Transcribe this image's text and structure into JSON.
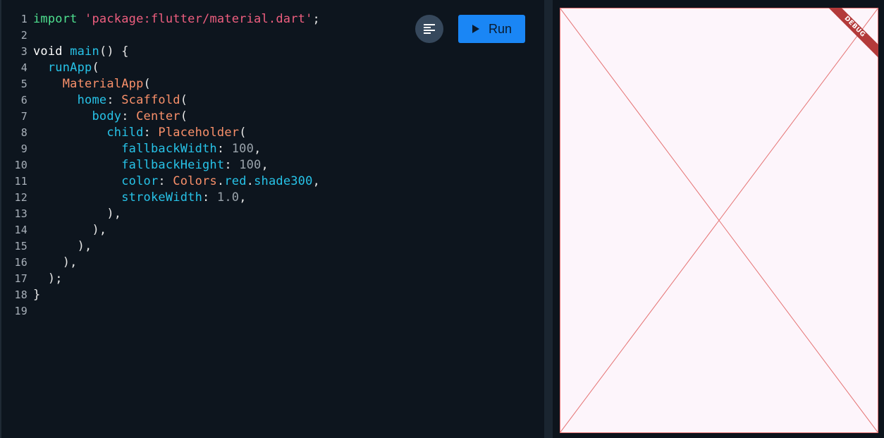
{
  "toolbar": {
    "format_icon": "format-align-left-icon",
    "run_label": "Run",
    "run_icon": "play-icon",
    "run_color": "#1a86f5"
  },
  "code": {
    "line_numbers": [
      "1",
      "2",
      "3",
      "4",
      "5",
      "6",
      "7",
      "8",
      "9",
      "10",
      "11",
      "12",
      "13",
      "14",
      "15",
      "16",
      "17",
      "18",
      "19"
    ],
    "lines": [
      [
        {
          "t": "import",
          "c": "kw-green"
        },
        {
          "t": " ",
          "c": "plain"
        },
        {
          "t": "'package:flutter/material.dart'",
          "c": "str"
        },
        {
          "t": ";",
          "c": "plain"
        }
      ],
      [],
      [
        {
          "t": "void",
          "c": "kw-white"
        },
        {
          "t": " ",
          "c": "plain"
        },
        {
          "t": "main",
          "c": "fn"
        },
        {
          "t": "() {",
          "c": "plain"
        }
      ],
      [
        {
          "t": "  ",
          "c": "plain"
        },
        {
          "t": "runApp",
          "c": "fn"
        },
        {
          "t": "(",
          "c": "plain"
        }
      ],
      [
        {
          "t": "    ",
          "c": "plain"
        },
        {
          "t": "MaterialApp",
          "c": "cls"
        },
        {
          "t": "(",
          "c": "plain"
        }
      ],
      [
        {
          "t": "      ",
          "c": "plain"
        },
        {
          "t": "home",
          "c": "fn"
        },
        {
          "t": ": ",
          "c": "plain"
        },
        {
          "t": "Scaffold",
          "c": "cls"
        },
        {
          "t": "(",
          "c": "plain"
        }
      ],
      [
        {
          "t": "        ",
          "c": "plain"
        },
        {
          "t": "body",
          "c": "fn"
        },
        {
          "t": ": ",
          "c": "plain"
        },
        {
          "t": "Center",
          "c": "cls"
        },
        {
          "t": "(",
          "c": "plain"
        }
      ],
      [
        {
          "t": "          ",
          "c": "plain"
        },
        {
          "t": "child",
          "c": "fn"
        },
        {
          "t": ": ",
          "c": "plain"
        },
        {
          "t": "Placeholder",
          "c": "cls"
        },
        {
          "t": "(",
          "c": "plain"
        }
      ],
      [
        {
          "t": "            ",
          "c": "plain"
        },
        {
          "t": "fallbackWidth",
          "c": "fn"
        },
        {
          "t": ": ",
          "c": "plain"
        },
        {
          "t": "100",
          "c": "num"
        },
        {
          "t": ",",
          "c": "plain"
        }
      ],
      [
        {
          "t": "            ",
          "c": "plain"
        },
        {
          "t": "fallbackHeight",
          "c": "fn"
        },
        {
          "t": ": ",
          "c": "plain"
        },
        {
          "t": "100",
          "c": "num"
        },
        {
          "t": ",",
          "c": "plain"
        }
      ],
      [
        {
          "t": "            ",
          "c": "plain"
        },
        {
          "t": "color",
          "c": "fn"
        },
        {
          "t": ": ",
          "c": "plain"
        },
        {
          "t": "Colors",
          "c": "cls"
        },
        {
          "t": ".",
          "c": "plain"
        },
        {
          "t": "red",
          "c": "fn"
        },
        {
          "t": ".",
          "c": "plain"
        },
        {
          "t": "shade300",
          "c": "fn"
        },
        {
          "t": ",",
          "c": "plain"
        }
      ],
      [
        {
          "t": "            ",
          "c": "plain"
        },
        {
          "t": "strokeWidth",
          "c": "fn"
        },
        {
          "t": ": ",
          "c": "plain"
        },
        {
          "t": "1.0",
          "c": "num"
        },
        {
          "t": ",",
          "c": "plain"
        }
      ],
      [
        {
          "t": "          ),",
          "c": "plain"
        }
      ],
      [
        {
          "t": "        ),",
          "c": "plain"
        }
      ],
      [
        {
          "t": "      ),",
          "c": "plain"
        }
      ],
      [
        {
          "t": "    ),",
          "c": "plain"
        }
      ],
      [
        {
          "t": "  );",
          "c": "plain"
        }
      ],
      [
        {
          "t": "}",
          "c": "plain"
        }
      ],
      []
    ]
  },
  "preview": {
    "background": "#fdf5fb",
    "placeholder_color": "#e57373",
    "debug_banner": "DEBUG"
  }
}
